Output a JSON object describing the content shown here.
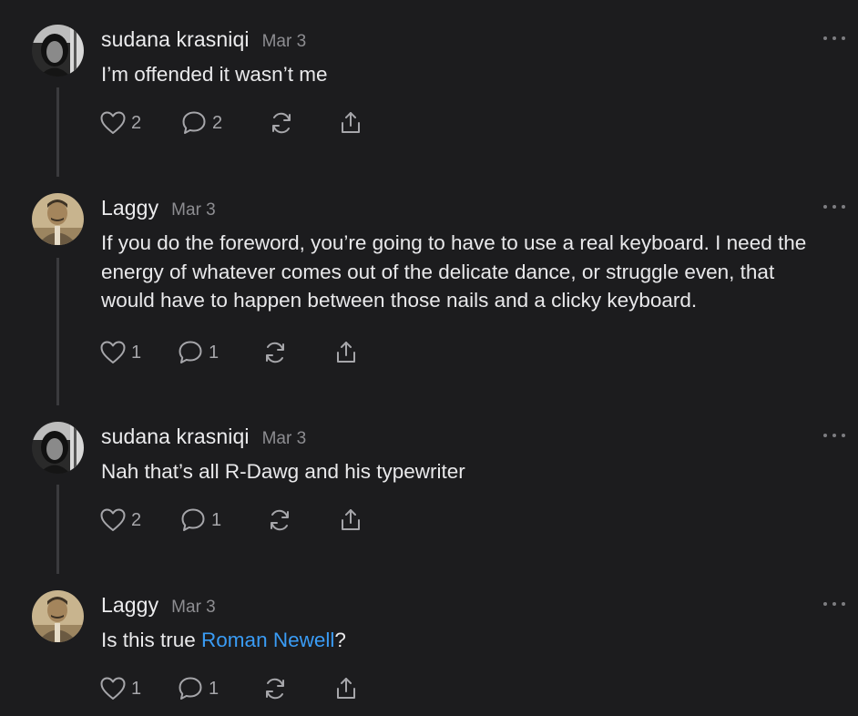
{
  "comments": [
    {
      "author": "sudana krasniqi",
      "date": "Mar 3",
      "text": "I’m offended it wasn’t me",
      "likes": "2",
      "replies": "2"
    },
    {
      "author": "Laggy",
      "date": "Mar 3",
      "text": "If you do the foreword, you’re going to have to use a real keyboard. I need the energy of whatever comes out of the delicate dance, or struggle even, that would have to happen between those nails and a clicky keyboard.",
      "likes": "1",
      "replies": "1"
    },
    {
      "author": "sudana krasniqi",
      "date": "Mar 3",
      "text": "Nah that’s all R-Dawg and his typewriter",
      "likes": "2",
      "replies": "1"
    },
    {
      "author": "Laggy",
      "date": "Mar 3",
      "text_prefix": "Is this true ",
      "mention": "Roman Newell",
      "text_suffix": "?",
      "likes": "1",
      "replies": "1"
    }
  ],
  "icons": {
    "like": "heart-icon",
    "reply": "speech-bubble-icon",
    "restack": "restack-icon",
    "share": "share-icon",
    "more": "more-horizontal-icon"
  },
  "colors": {
    "background": "#1c1c1e",
    "mention": "#3a9cf5",
    "muted": "#8d8d91"
  }
}
